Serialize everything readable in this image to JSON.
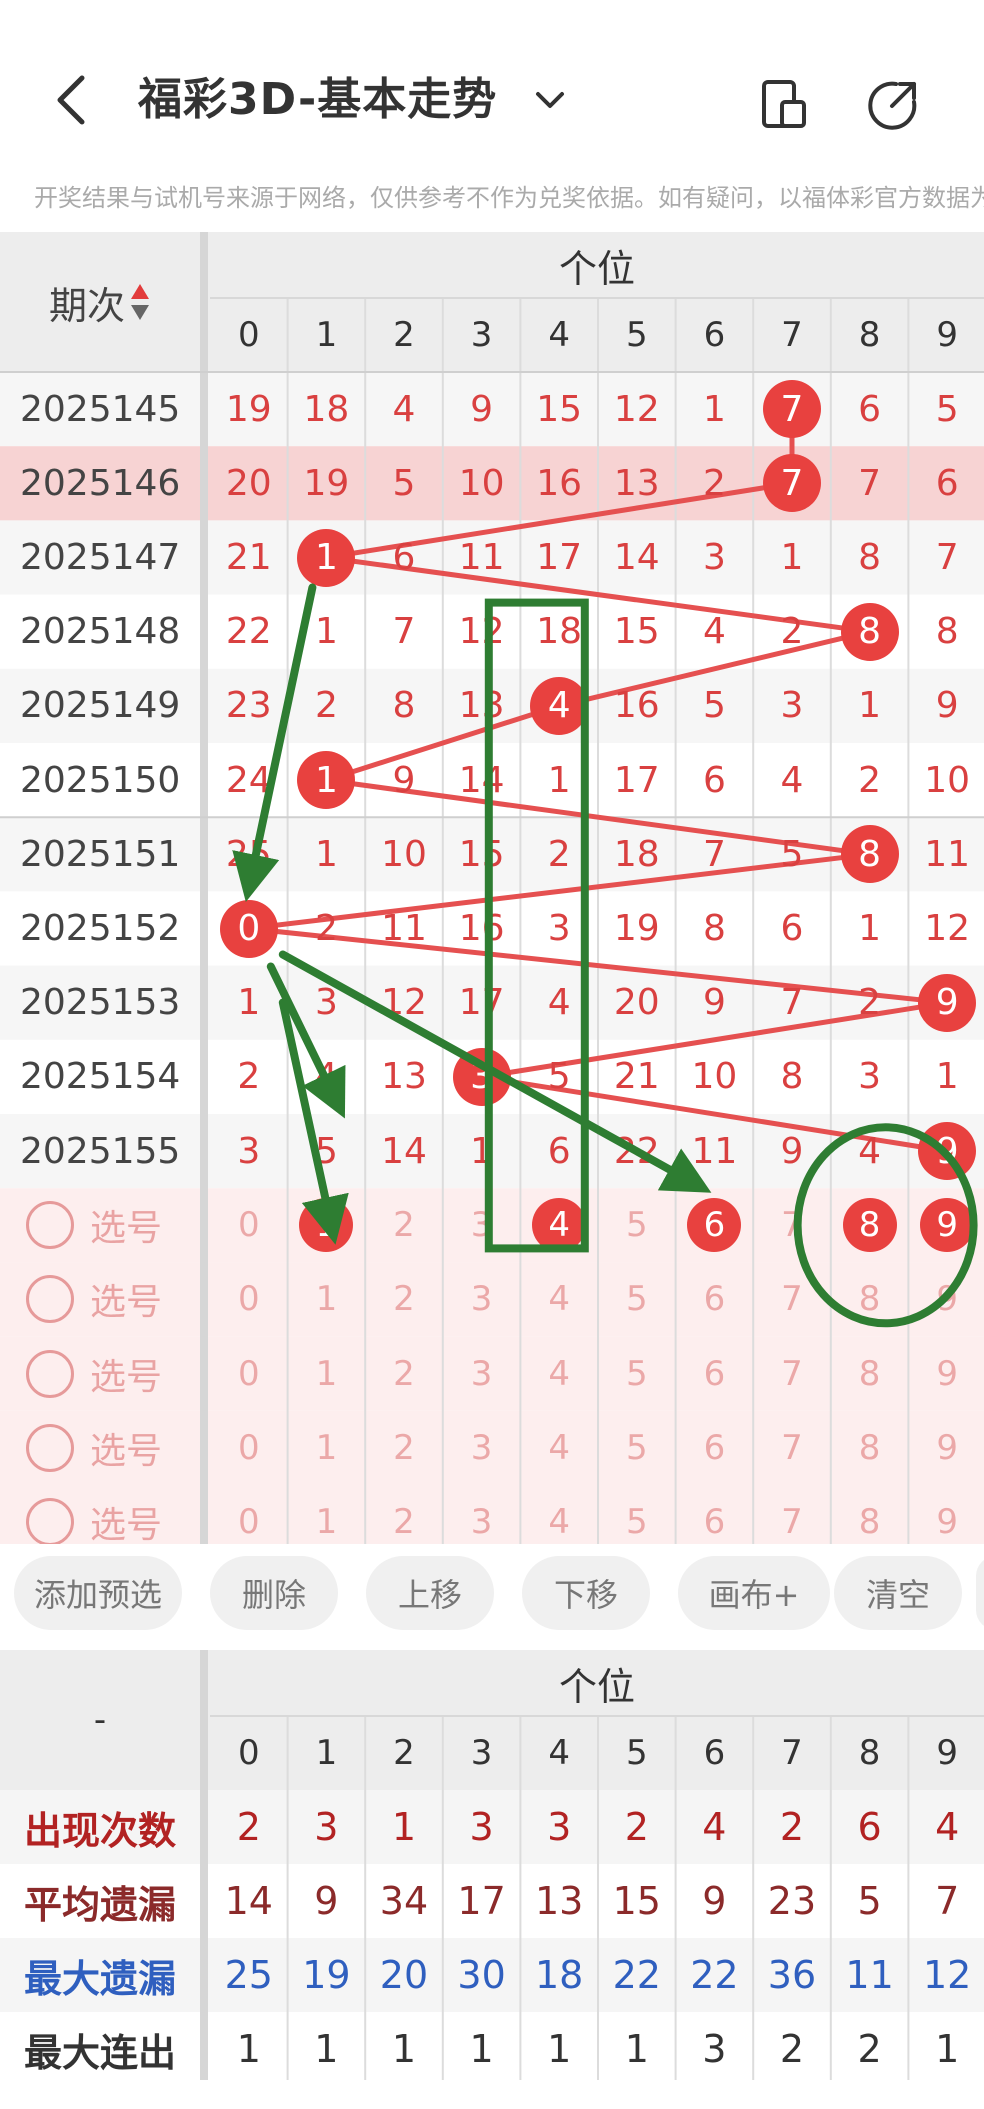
{
  "header": {
    "title": "福彩3D-基本走势",
    "disclaimer": "开奖结果与试机号来源于网络，仅供参考不作为兑奖依据。如有疑问，以福体彩官方数据为"
  },
  "grid": {
    "period_header": "期次",
    "group_header": "个位",
    "digits": [
      "0",
      "1",
      "2",
      "3",
      "4",
      "5",
      "6",
      "7",
      "8",
      "9"
    ],
    "rows": [
      {
        "period": "2025145",
        "values": [
          "19",
          "18",
          "4",
          "9",
          "15",
          "12",
          "1",
          "7",
          "6",
          "5"
        ],
        "hit": 7,
        "highlight": false
      },
      {
        "period": "2025146",
        "values": [
          "20",
          "19",
          "5",
          "10",
          "16",
          "13",
          "2",
          "7",
          "7",
          "6"
        ],
        "hit": 7,
        "highlight": true
      },
      {
        "period": "2025147",
        "values": [
          "21",
          "1",
          "6",
          "11",
          "17",
          "14",
          "3",
          "1",
          "8",
          "7"
        ],
        "hit": 1,
        "highlight": false
      },
      {
        "period": "2025148",
        "values": [
          "22",
          "1",
          "7",
          "12",
          "18",
          "15",
          "4",
          "2",
          "8",
          "8"
        ],
        "hit": 8,
        "highlight": false
      },
      {
        "period": "2025149",
        "values": [
          "23",
          "2",
          "8",
          "13",
          "4",
          "16",
          "5",
          "3",
          "1",
          "9"
        ],
        "hit": 4,
        "highlight": false
      },
      {
        "period": "2025150",
        "values": [
          "24",
          "1",
          "9",
          "14",
          "1",
          "17",
          "6",
          "4",
          "2",
          "10"
        ],
        "hit": 1,
        "highlight": false
      },
      {
        "period": "2025151",
        "values": [
          "25",
          "1",
          "10",
          "15",
          "2",
          "18",
          "7",
          "5",
          "8",
          "11"
        ],
        "hit": 8,
        "highlight": false
      },
      {
        "period": "2025152",
        "values": [
          "0",
          "2",
          "11",
          "16",
          "3",
          "19",
          "8",
          "6",
          "1",
          "12"
        ],
        "hit": 0,
        "highlight": false
      },
      {
        "period": "2025153",
        "values": [
          "1",
          "3",
          "12",
          "17",
          "4",
          "20",
          "9",
          "7",
          "2",
          "9"
        ],
        "hit": 9,
        "highlight": false
      },
      {
        "period": "2025154",
        "values": [
          "2",
          "4",
          "13",
          "3",
          "5",
          "21",
          "10",
          "8",
          "3",
          "1"
        ],
        "hit": 3,
        "highlight": false
      },
      {
        "period": "2025155",
        "values": [
          "3",
          "5",
          "14",
          "1",
          "6",
          "22",
          "11",
          "9",
          "4",
          "9"
        ],
        "hit": 9,
        "highlight": false
      }
    ],
    "select_label": "选号",
    "select_rows": [
      {
        "values": [
          "0",
          "1",
          "2",
          "3",
          "4",
          "5",
          "6",
          "7",
          "8",
          "9"
        ],
        "picked": [
          1,
          4,
          6,
          8,
          9
        ]
      },
      {
        "values": [
          "0",
          "1",
          "2",
          "3",
          "4",
          "5",
          "6",
          "7",
          "8",
          "9"
        ],
        "picked": []
      },
      {
        "values": [
          "0",
          "1",
          "2",
          "3",
          "4",
          "5",
          "6",
          "7",
          "8",
          "9"
        ],
        "picked": []
      },
      {
        "values": [
          "0",
          "1",
          "2",
          "3",
          "4",
          "5",
          "6",
          "7",
          "8",
          "9"
        ],
        "picked": []
      },
      {
        "values": [
          "0",
          "1",
          "2",
          "3",
          "4",
          "5",
          "6",
          "7",
          "8",
          "9"
        ],
        "picked": []
      }
    ]
  },
  "buttons": [
    "添加预选",
    "删除",
    "上移",
    "下移",
    "画布+",
    "清空"
  ],
  "stats": {
    "corner": "-",
    "group_header": "个位",
    "digits": [
      "0",
      "1",
      "2",
      "3",
      "4",
      "5",
      "6",
      "7",
      "8",
      "9"
    ],
    "rows": [
      {
        "label": "出现次数",
        "values": [
          "2",
          "3",
          "1",
          "3",
          "3",
          "2",
          "4",
          "2",
          "6",
          "4"
        ],
        "color": "#b22222"
      },
      {
        "label": "平均遗漏",
        "values": [
          "14",
          "9",
          "34",
          "17",
          "13",
          "15",
          "9",
          "23",
          "5",
          "7"
        ],
        "color": "#8b2a2a"
      },
      {
        "label": "最大遗漏",
        "values": [
          "25",
          "19",
          "20",
          "30",
          "18",
          "22",
          "22",
          "36",
          "11",
          "12"
        ],
        "color": "#2f5fbf"
      },
      {
        "label": "最大连出",
        "values": [
          "1",
          "1",
          "1",
          "1",
          "1",
          "1",
          "3",
          "2",
          "2",
          "1"
        ],
        "color": "#333333"
      }
    ]
  },
  "colors": {
    "ball": "#e8413f",
    "highlight_row": "#f7d3d3",
    "select_bg": "#fdeeee",
    "annotation": "#2e7d32"
  }
}
